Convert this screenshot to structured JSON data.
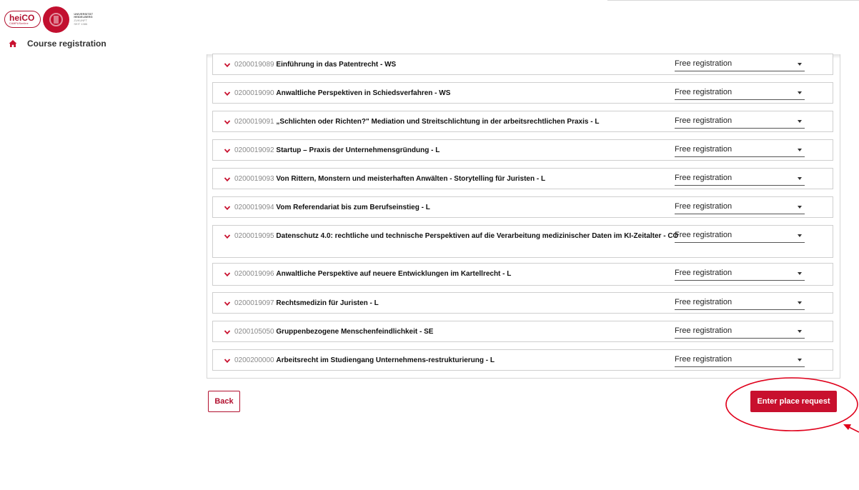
{
  "header": {
    "logo": {
      "heico_text": "heiCO",
      "heico_sub": "CAMPUSonline",
      "university_lines": [
        "Universität",
        "Heidelberg",
        "Zukunft",
        "seit 1386"
      ]
    },
    "breadcrumb": {
      "icon": "home-icon",
      "label": "Course registration"
    }
  },
  "courses": [
    {
      "code": "0200019089",
      "title": "Einführung in das Patentrecht - WS",
      "registration": "Free registration"
    },
    {
      "code": "0200019090",
      "title": "Anwaltliche Perspektiven in Schiedsverfahren - WS",
      "registration": "Free registration"
    },
    {
      "code": "0200019091",
      "title": "„Schlichten oder Richten?\" Mediation und Streitschlichtung in der arbeitsrechtlichen Praxis - L",
      "registration": "Free registration"
    },
    {
      "code": "0200019092",
      "title": "Startup – Praxis der Unternehmensgründung - L",
      "registration": "Free registration"
    },
    {
      "code": "0200019093",
      "title": "Von Rittern, Monstern und meisterhaften Anwälten - Storytelling für Juristen - L",
      "registration": "Free registration"
    },
    {
      "code": "0200019094",
      "title": "Vom Referendariat bis zum Berufseinstieg - L",
      "registration": "Free registration"
    },
    {
      "code": "0200019095",
      "title": "Datenschutz 4.0: rechtliche und technische Perspektiven auf die Verarbeitung medizinischer Daten im KI-Zeitalter - CO",
      "registration": "Free registration"
    },
    {
      "code": "0200019096",
      "title": "Anwaltliche Perspektive auf neuere Entwicklungen im Kartellrecht - L",
      "registration": "Free registration"
    },
    {
      "code": "0200019097",
      "title": "Rechtsmedizin für Juristen - L",
      "registration": "Free registration"
    },
    {
      "code": "0200105050",
      "title": "Gruppenbezogene Menschenfeindlichkeit - SE",
      "registration": "Free registration"
    },
    {
      "code": "0200200000",
      "title": "Arbeitsrecht im Studiengang Unternehmens-restrukturierung - L",
      "registration": "Free registration"
    }
  ],
  "actions": {
    "back_label": "Back",
    "enter_label": "Enter place request"
  },
  "colors": {
    "brand_red": "#c8102e",
    "annotation_red": "#e0001b"
  }
}
